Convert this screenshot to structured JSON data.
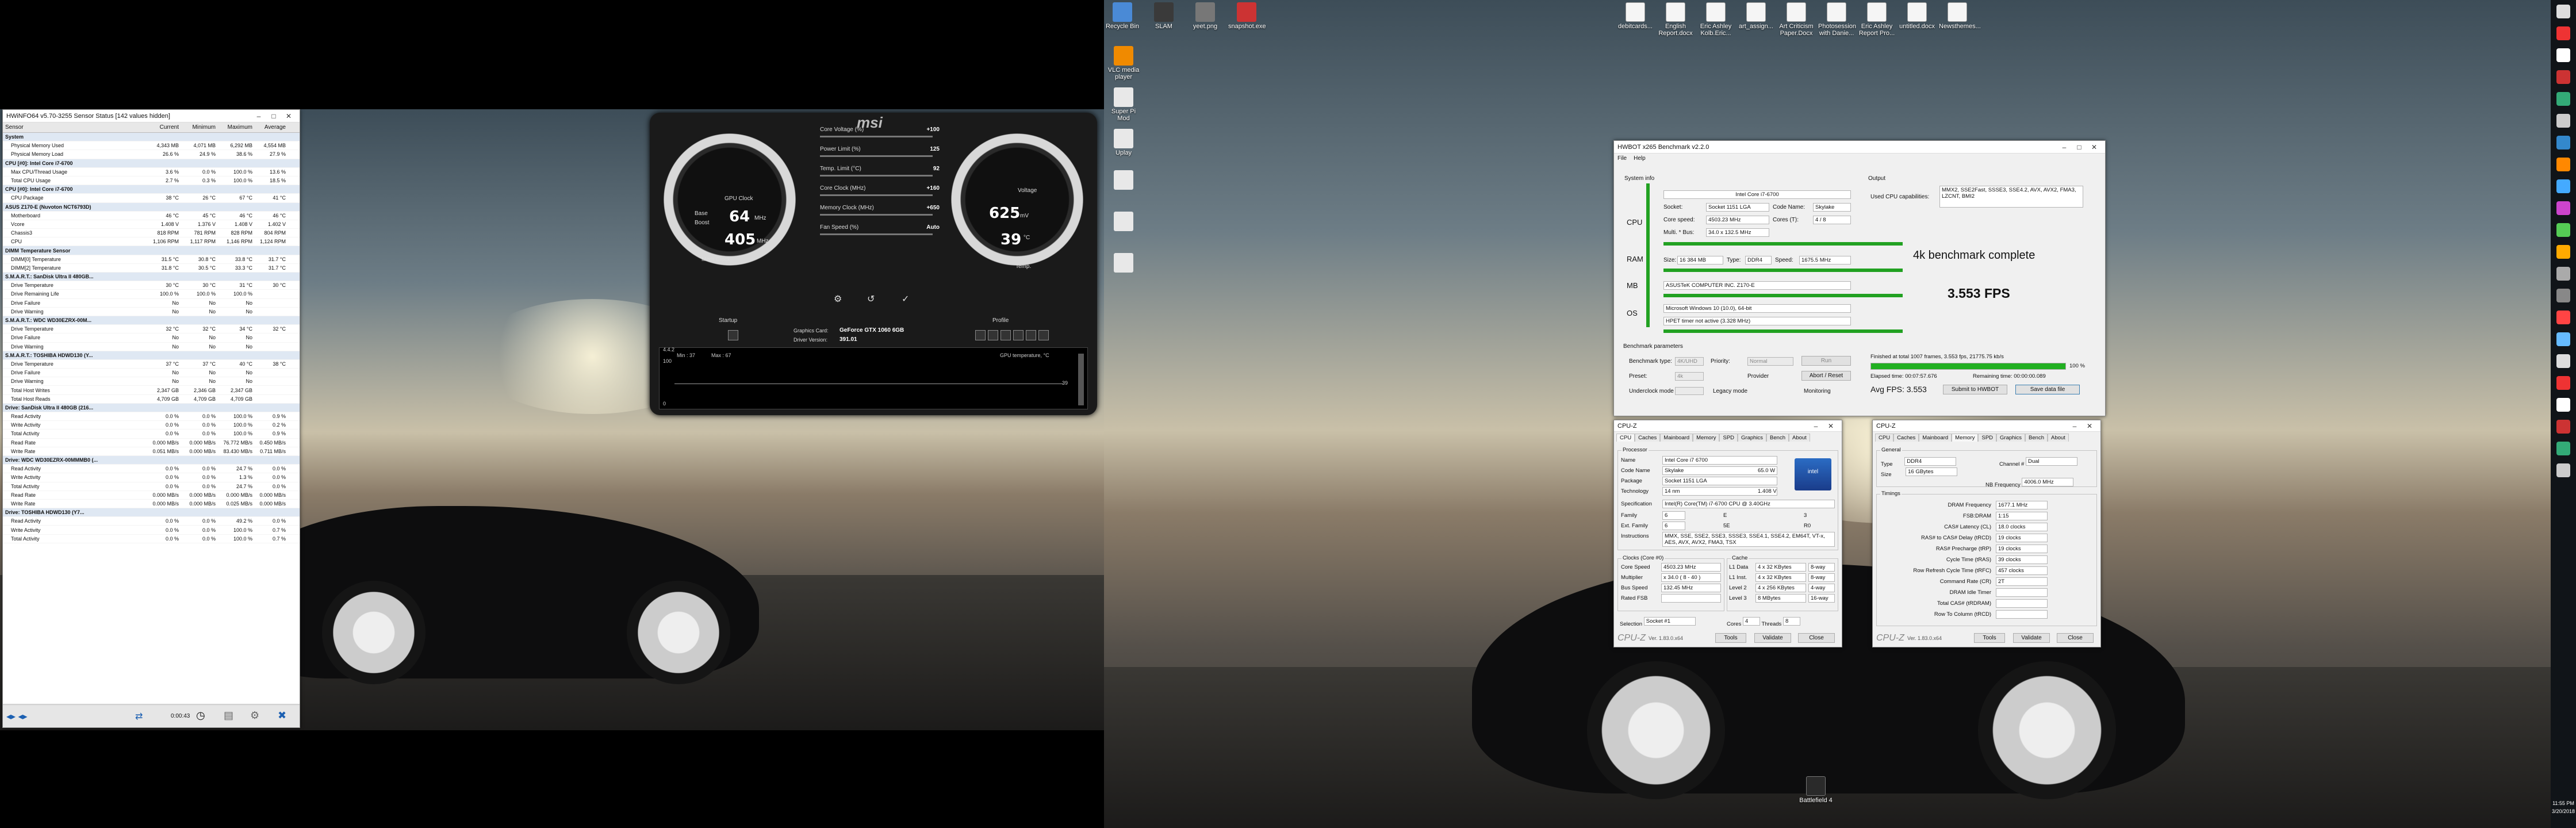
{
  "hwinfo": {
    "title": "HWiNFO64 v5.70-3255 Sensor Status [142 values hidden]",
    "columns": [
      "Sensor",
      "Current",
      "Minimum",
      "Maximum",
      "Average"
    ],
    "rows": [
      {
        "g": 1,
        "n": "System"
      },
      {
        "n": "Physical Memory Used",
        "v": [
          "4,343 MB",
          "4,071 MB",
          "6,292 MB",
          "4,554 MB"
        ]
      },
      {
        "n": "Physical Memory Load",
        "v": [
          "26.6 %",
          "24.9 %",
          "38.6 %",
          "27.9 %"
        ]
      },
      {
        "g": 1,
        "n": "CPU [#0]: Intel Core i7-6700"
      },
      {
        "n": "Max CPU/Thread Usage",
        "v": [
          "3.6 %",
          "0.0 %",
          "100.0 %",
          "13.6 %"
        ]
      },
      {
        "n": "Total CPU Usage",
        "v": [
          "2.7 %",
          "0.3 %",
          "100.0 %",
          "18.5 %"
        ]
      },
      {
        "g": 1,
        "n": "CPU [#0]: Intel Core i7-6700"
      },
      {
        "n": "CPU Package",
        "v": [
          "38 °C",
          "26 °C",
          "67 °C",
          "41 °C"
        ]
      },
      {
        "g": 1,
        "n": "ASUS Z170-E (Nuvoton NCT6793D)"
      },
      {
        "n": "Motherboard",
        "v": [
          "46 °C",
          "45 °C",
          "46 °C",
          "46 °C"
        ]
      },
      {
        "n": "Vcore",
        "v": [
          "1.408 V",
          "1.376 V",
          "1.408 V",
          "1.402 V"
        ]
      },
      {
        "n": "Chassis3",
        "v": [
          "818 RPM",
          "781 RPM",
          "828 RPM",
          "804 RPM"
        ]
      },
      {
        "n": "CPU",
        "v": [
          "1,106 RPM",
          "1,117 RPM",
          "1,146 RPM",
          "1,124 RPM"
        ]
      },
      {
        "g": 1,
        "n": "DIMM Temperature Sensor"
      },
      {
        "n": "DIMM[0] Temperature",
        "v": [
          "31.5 °C",
          "30.8 °C",
          "33.8 °C",
          "31.7 °C"
        ]
      },
      {
        "n": "DIMM[2] Temperature",
        "v": [
          "31.8 °C",
          "30.5 °C",
          "33.3 °C",
          "31.7 °C"
        ]
      },
      {
        "g": 1,
        "n": "S.M.A.R.T.: SanDisk Ultra II 480GB..."
      },
      {
        "n": "Drive Temperature",
        "v": [
          "30 °C",
          "30 °C",
          "31 °C",
          "30 °C"
        ]
      },
      {
        "n": "Drive Remaining Life",
        "v": [
          "100.0 %",
          "100.0 %",
          "100.0 %",
          ""
        ]
      },
      {
        "n": "Drive Failure",
        "v": [
          "No",
          "No",
          "No",
          ""
        ]
      },
      {
        "n": "Drive Warning",
        "v": [
          "No",
          "No",
          "No",
          ""
        ]
      },
      {
        "g": 1,
        "n": "S.M.A.R.T.: WDC WD30EZRX-00M..."
      },
      {
        "n": "Drive Temperature",
        "v": [
          "32 °C",
          "32 °C",
          "34 °C",
          "32 °C"
        ]
      },
      {
        "n": "Drive Failure",
        "v": [
          "No",
          "No",
          "No",
          ""
        ]
      },
      {
        "n": "Drive Warning",
        "v": [
          "No",
          "No",
          "No",
          ""
        ]
      },
      {
        "g": 1,
        "n": "S.M.A.R.T.: TOSHIBA HDWD130 (Y..."
      },
      {
        "n": "Drive Temperature",
        "v": [
          "37 °C",
          "37 °C",
          "40 °C",
          "38 °C"
        ]
      },
      {
        "n": "Drive Failure",
        "v": [
          "No",
          "No",
          "No",
          ""
        ]
      },
      {
        "n": "Drive Warning",
        "v": [
          "No",
          "No",
          "No",
          ""
        ]
      },
      {
        "n": "Total Host Writes",
        "v": [
          "2,347 GB",
          "2,346 GB",
          "2,347 GB",
          ""
        ]
      },
      {
        "n": "Total Host Reads",
        "v": [
          "4,709 GB",
          "4,709 GB",
          "4,709 GB",
          ""
        ]
      },
      {
        "g": 1,
        "n": "Drive: SanDisk Ultra II 480GB (216..."
      },
      {
        "n": "Read Activity",
        "v": [
          "0.0 %",
          "0.0 %",
          "100.0 %",
          "0.9 %"
        ]
      },
      {
        "n": "Write Activity",
        "v": [
          "0.0 %",
          "0.0 %",
          "100.0 %",
          "0.2 %"
        ]
      },
      {
        "n": "Total Activity",
        "v": [
          "0.0 %",
          "0.0 %",
          "100.0 %",
          "0.9 %"
        ]
      },
      {
        "n": "Read Rate",
        "v": [
          "0.000 MB/s",
          "0.000 MB/s",
          "76.772 MB/s",
          "0.450 MB/s"
        ]
      },
      {
        "n": "Write Rate",
        "v": [
          "0.051 MB/s",
          "0.000 MB/s",
          "83.430 MB/s",
          "0.711 MB/s"
        ]
      },
      {
        "g": 1,
        "n": "Drive: WDC WD30EZRX-00MMMB0 (..."
      },
      {
        "n": "Read Activity",
        "v": [
          "0.0 %",
          "0.0 %",
          "24.7 %",
          "0.0 %"
        ]
      },
      {
        "n": "Write Activity",
        "v": [
          "0.0 %",
          "0.0 %",
          "1.3 %",
          "0.0 %"
        ]
      },
      {
        "n": "Total Activity",
        "v": [
          "0.0 %",
          "0.0 %",
          "24.7 %",
          "0.0 %"
        ]
      },
      {
        "n": "Read Rate",
        "v": [
          "0.000 MB/s",
          "0.000 MB/s",
          "0.000 MB/s",
          "0.000 MB/s"
        ]
      },
      {
        "n": "Write Rate",
        "v": [
          "0.000 MB/s",
          "0.000 MB/s",
          "0.025 MB/s",
          "0.000 MB/s"
        ]
      },
      {
        "g": 1,
        "n": "Drive: TOSHIBA HDWD130 (Y7..."
      },
      {
        "n": "Read Activity",
        "v": [
          "0.0 %",
          "0.0 %",
          "49.2 %",
          "0.0 %"
        ]
      },
      {
        "n": "Write Activity",
        "v": [
          "0.0 %",
          "0.0 %",
          "100.0 %",
          "0.7 %"
        ]
      },
      {
        "n": "Total Activity",
        "v": [
          "0.0 %",
          "0.0 %",
          "100.0 %",
          "0.7 %"
        ]
      }
    ],
    "footer_time": "0:00:43"
  },
  "msi": {
    "brand": "msi",
    "version": "4.4.2",
    "gpu_clock": "64",
    "gpu_clock_unit": "MHz",
    "mem_clock": "405",
    "mem_clock_unit": "MHz",
    "voltage": "625",
    "voltage_unit": "mV",
    "temp": "39",
    "temp_unit": "°C",
    "label_base": "Base",
    "label_boost": "Boost",
    "label_mem": "Mem Clock",
    "label_gpu": "GPU Clock",
    "label_voltage": "Voltage",
    "label_temp": "Temp.",
    "sliders": [
      {
        "l": "Core Voltage (%)",
        "v": "+100"
      },
      {
        "l": "Power Limit (%)",
        "v": "125"
      },
      {
        "l": "Temp. Limit (°C)",
        "v": "92"
      },
      {
        "l": "Core Clock (MHz)",
        "v": "+160"
      },
      {
        "l": "Memory Clock (MHz)",
        "v": "+650"
      },
      {
        "l": "Fan Speed (%)",
        "v": "Auto"
      }
    ],
    "startup": "Startup",
    "profile": "Profile",
    "graphics_card_label": "Graphics Card:",
    "graphics_card": "GeForce GTX 1060 6GB",
    "driver_label": "Driver Version:",
    "driver": "391.01",
    "graph_label": "GPU temperature, °C",
    "graph_min": "Min : 37",
    "graph_max": "Max : 67",
    "graph_top": "100",
    "graph_cur": "39",
    "graph_zero": "0"
  },
  "hwbot": {
    "title": "HWBOT x265 Benchmark v2.2.0",
    "menu": [
      "File",
      "Help"
    ],
    "sysinfo": "System info",
    "cpu_name": "Intel Core i7-6700",
    "socket_label": "Socket:",
    "socket": "Socket 1151 LGA",
    "codename_label": "Code Name:",
    "codename": "Skylake",
    "corespeed_label": "Core speed:",
    "corespeed": "4503.23 MHz",
    "cores_label": "Cores (T):",
    "cores": "4 / 8",
    "multi_label": "Multi. * Bus:",
    "multi": "34.0 x 132.5 MHz",
    "size_label": "Size:",
    "mem_size": "16 384 MB",
    "type_label": "Type:",
    "mem_type": "DDR4",
    "speed_label": "Speed:",
    "mem_speed": "1675.5 MHz",
    "mb": "ASUSTeK COMPUTER INC. Z170-E",
    "os": "Microsoft Windows 10 (10.0), 64-bit",
    "hpet": "HPET timer not active (3.328 MHz)",
    "sec": [
      "CPU",
      "RAM",
      "MB",
      "OS"
    ],
    "output_label": "Output",
    "caps_label": "Used CPU capabilities:",
    "caps": "MMX2, SSE2Fast, SSSE3, SSE4.2, AVX, AVX2, FMA3, LZCNT, BMI2",
    "result_title": "4k benchmark complete",
    "fps": "3.553 FPS",
    "params_label": "Benchmark parameters",
    "btype_label": "Benchmark type:",
    "btype": "4K/UHD",
    "prio_label": "Priority:",
    "prio": "Normal",
    "run": "Run",
    "preset_label": "Preset:",
    "preset": "4k",
    "provider": "Provider",
    "underclock_label": "Underclock mode",
    "legacy": "Legacy mode",
    "monitoring": "Monitoring",
    "abort": "Abort / Reset",
    "finished": "Finished at total 1007 frames, 3.553 fps, 21775.75 kb/s",
    "progress": "100 %",
    "elapsed": "Elapsed time: 00:07:57.676",
    "remaining": "Remaining time: 00:00:00.089",
    "avg": "Avg FPS: 3.553",
    "submit": "Submit to HWBOT",
    "save": "Save data file"
  },
  "cpuz1": {
    "title": "CPU-Z",
    "tabs": [
      "CPU",
      "Caches",
      "Mainboard",
      "Memory",
      "SPD",
      "Graphics",
      "Bench",
      "About"
    ],
    "active": 0,
    "rows": [
      [
        "Name",
        "Intel Core i7 6700"
      ],
      [
        "Code Name",
        "Skylake"
      ],
      [
        "Package",
        "Socket 1151 LGA"
      ],
      [
        "Technology",
        "14 nm"
      ],
      [
        "Specification",
        "Intel(R) Core(TM) i7-6700 CPU @ 3.40GHz"
      ],
      [
        "Family",
        "6"
      ],
      [
        "Ext. Family",
        "6"
      ],
      [
        "Instructions",
        "MMX, SSE, SSE2, SSE3, SSSE3, SSE4.1, SSE4.2, EM64T, VT-x, AES, AVX, AVX2, FMA3, TSX"
      ]
    ],
    "maxtdp": "65.0 W",
    "corev": "1.408 V",
    "model": "E",
    "stepping": "3",
    "extmodel": "5E",
    "revision": "R0",
    "clocks": [
      [
        "Core Speed",
        "4503.23 MHz"
      ],
      [
        "Multiplier",
        "x 34.0 ( 8 - 40 )"
      ],
      [
        "Bus Speed",
        "132.45 MHz"
      ],
      [
        "Rated FSB",
        ""
      ]
    ],
    "cache": [
      [
        "L1 Data",
        "4 x 32 KBytes",
        "8-way"
      ],
      [
        "L1 Inst.",
        "4 x 32 KBytes",
        "8-way"
      ],
      [
        "Level 2",
        "4 x 256 KBytes",
        "4-way"
      ],
      [
        "Level 3",
        "8 MBytes",
        "16-way"
      ]
    ],
    "selection": "Socket #1",
    "cores": "4",
    "threads": "8",
    "ver": "Ver. 1.83.0.x64",
    "tools": "Tools",
    "validate": "Validate",
    "close": "Close",
    "clocks_label": "Clocks (Core #0)",
    "cache_label": "Cache",
    "proc_label": "Processor"
  },
  "cpuz2": {
    "title": "CPU-Z",
    "tabs": [
      "CPU",
      "Caches",
      "Mainboard",
      "Memory",
      "SPD",
      "Graphics",
      "Bench",
      "About"
    ],
    "active": 3,
    "general_label": "General",
    "timings_label": "Timings",
    "type": "DDR4",
    "channel": "Dual",
    "size": "16 GBytes",
    "nbfreq": "4006.0 MHz",
    "timings": [
      [
        "DRAM Frequency",
        "1677.1 MHz"
      ],
      [
        "FSB:DRAM",
        "1:15"
      ],
      [
        "CAS# Latency (CL)",
        "18.0 clocks"
      ],
      [
        "RAS# to CAS# Delay (tRCD)",
        "19 clocks"
      ],
      [
        "RAS# Precharge (tRP)",
        "19 clocks"
      ],
      [
        "Cycle Time (tRAS)",
        "39 clocks"
      ],
      [
        "Row Refresh Cycle Time (tRFC)",
        "457 clocks"
      ],
      [
        "Command Rate (CR)",
        "2T"
      ],
      [
        "DRAM Idle Timer",
        ""
      ],
      [
        "Total CAS# (tRDRAM)",
        ""
      ],
      [
        "Row To Column (tRCD)",
        ""
      ]
    ],
    "ver": "Ver. 1.83.0.x64",
    "tools": "Tools",
    "validate": "Validate",
    "close": "Close"
  },
  "desktop": {
    "left_icons": [
      "Recycle Bin",
      "SLAM",
      "yeet.png",
      "snapshot.exe"
    ],
    "left_col": [
      "VLC media player",
      "Super Pi Mod",
      "Uplay",
      "",
      "",
      ""
    ],
    "right_icons": [
      "debitcards...",
      "English Report.docx",
      "Eric Ashley Kolb.Eric...",
      "art_assign...",
      "Art Criticism Paper.Docx",
      "Photosession with Danie...",
      "Eric Ashley Report Pro...",
      "untitled.docx",
      "Newsthemes..."
    ],
    "bottom_icon": "Battlefield 4",
    "time": "11:55 PM",
    "date": "3/20/2018"
  }
}
